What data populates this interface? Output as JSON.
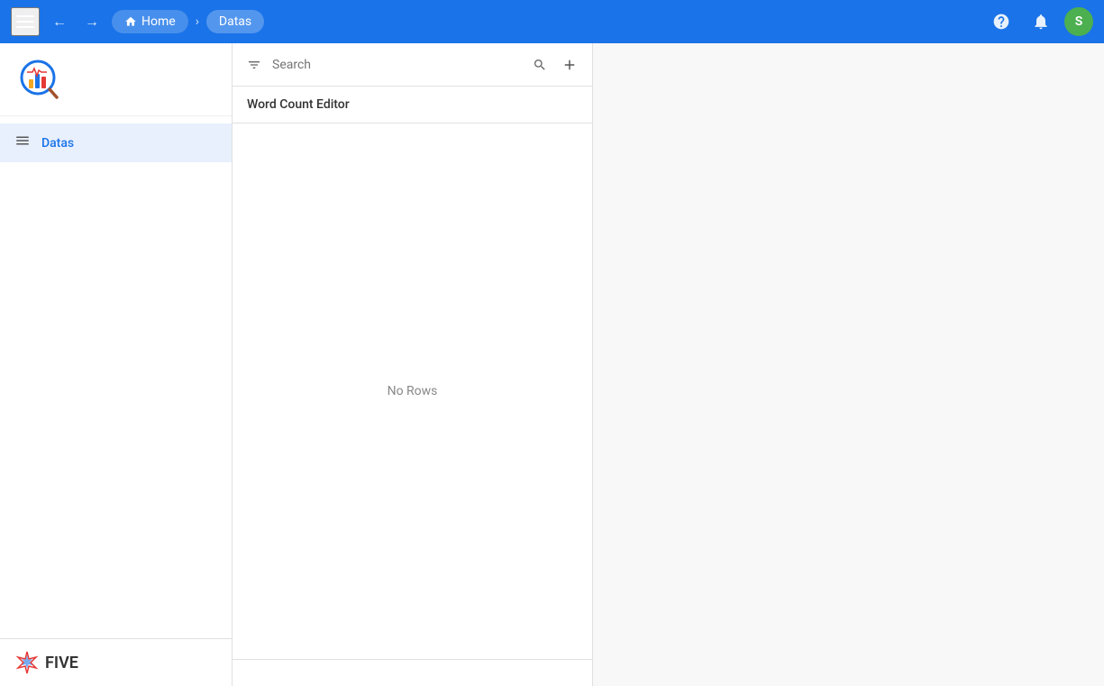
{
  "topbar": {
    "menu_label": "menu",
    "home_label": "Home",
    "datas_label": "Datas",
    "help_icon": "?",
    "bell_icon": "🔔",
    "avatar_letter": "S",
    "avatar_bg": "#4caf50"
  },
  "sidebar": {
    "nav_icon": "≡",
    "item_label": "Datas"
  },
  "data_panel": {
    "search_placeholder": "Search",
    "header_title": "Word Count Editor",
    "no_rows_text": "No Rows"
  },
  "footer": {
    "logo_text": "FIVE"
  }
}
